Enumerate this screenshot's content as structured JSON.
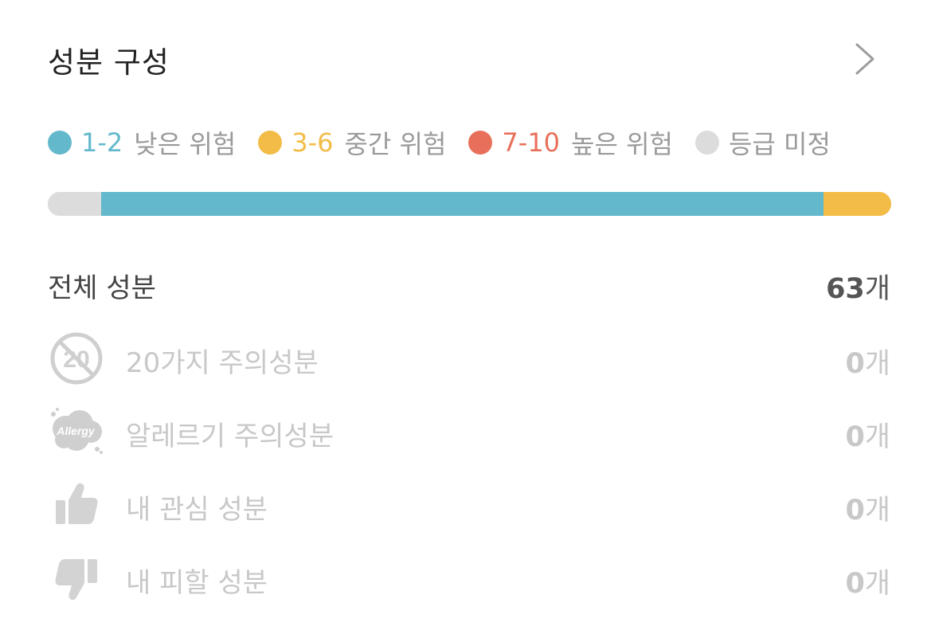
{
  "header": {
    "title": "성분 구성"
  },
  "legend": [
    {
      "range": "1-2",
      "text": "낮은 위험",
      "color": "#63b8cc"
    },
    {
      "range": "3-6",
      "text": "중간 위험",
      "color": "#f3bc47"
    },
    {
      "range": "7-10",
      "text": "높은 위험",
      "color": "#e8705a"
    },
    {
      "range": "",
      "text": "등급 미정",
      "color": "#dcdcdc"
    }
  ],
  "risk_bar": [
    {
      "group": "등급 미정",
      "fraction": 0.063,
      "color": "#dcdcdc"
    },
    {
      "group": "1-2",
      "fraction": 0.857,
      "color": "#63b8cc"
    },
    {
      "group": "3-6",
      "fraction": 0.08,
      "color": "#f3bc47"
    }
  ],
  "total": {
    "label": "전체 성분",
    "count": "63",
    "unit": "개"
  },
  "rows": [
    {
      "label": "20가지 주의성분",
      "count": "0",
      "unit": "개",
      "icon": "twenty-badge-icon",
      "badge_text": "20"
    },
    {
      "label": "알레르기 주의성분",
      "count": "0",
      "unit": "개",
      "icon": "allergy-cloud-icon",
      "badge_text": "Allergy"
    },
    {
      "label": "내 관심 성분",
      "count": "0",
      "unit": "개",
      "icon": "thumbs-up-icon"
    },
    {
      "label": "내 피할 성분",
      "count": "0",
      "unit": "개",
      "icon": "thumbs-down-icon"
    }
  ]
}
